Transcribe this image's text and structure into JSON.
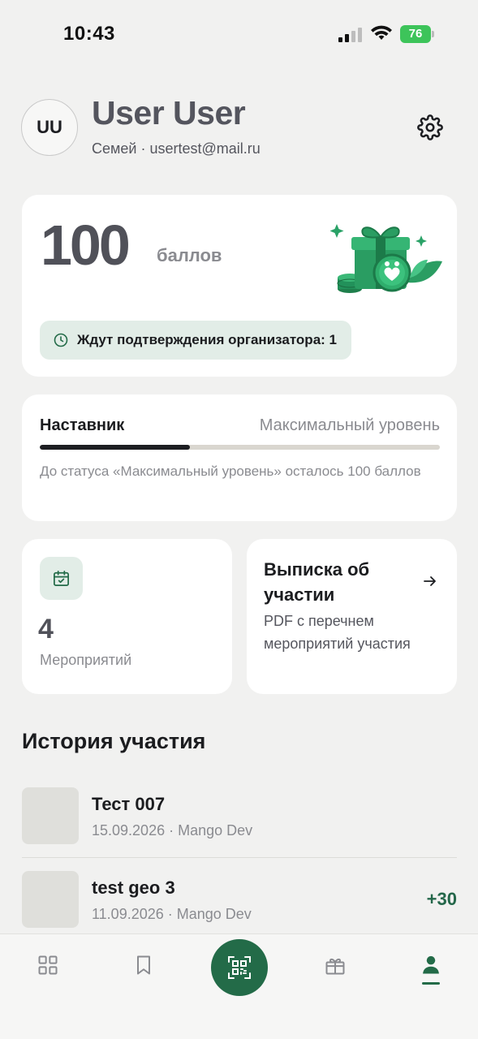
{
  "status_bar": {
    "time": "10:43",
    "battery": "76"
  },
  "profile": {
    "initials": "UU",
    "name": "User User",
    "subtitle": "Семей · usertest@mail.ru"
  },
  "points": {
    "value": "100",
    "unit": "баллов",
    "pending_label": "Ждут подтверждения организатора: 1"
  },
  "level": {
    "current": "Наставник",
    "next": "Максимальный уровень",
    "progress": 0.375,
    "note": "До статуса «Максимальный уровень» осталось 100 баллов"
  },
  "events": {
    "count": "4",
    "label": "Мероприятий"
  },
  "statement": {
    "title": "Выписка об участии",
    "description": "PDF с перечнем мероприятий участия"
  },
  "history": {
    "title": "История участия",
    "items": [
      {
        "title": "Тест 007",
        "meta": "15.09.2026 · Mango Dev",
        "points": ""
      },
      {
        "title": "test geo 3",
        "meta": "11.09.2026 · Mango Dev",
        "points": "+30"
      }
    ]
  },
  "colors": {
    "accent": "#236b48",
    "accent_light": "#e2ede7",
    "background": "#f1f1f0",
    "card": "#ffffff",
    "muted_text": "#8a8b90"
  },
  "nav": {
    "items": [
      "grid-icon",
      "bookmark-icon",
      "qr-icon",
      "gift-icon",
      "profile-icon"
    ],
    "active": "profile-icon"
  }
}
